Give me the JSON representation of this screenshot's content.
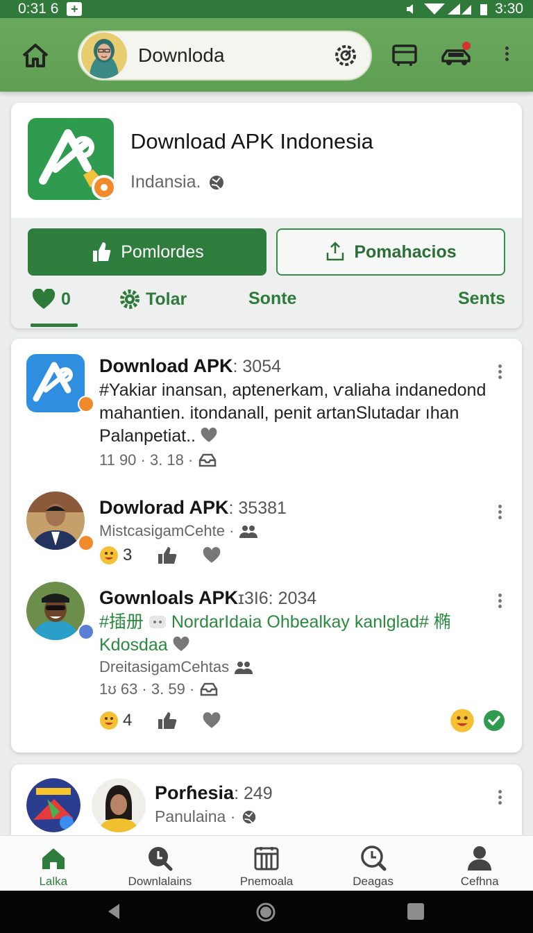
{
  "status_bar": {
    "time_left": "0:31 6",
    "time_right": "3:30"
  },
  "app_bar": {
    "search_text": "Downloda",
    "icons": [
      "home-icon",
      "gear-icon",
      "storefront-icon",
      "car-icon",
      "more-vert-icon"
    ],
    "accent": "#2e7d3c"
  },
  "hero": {
    "title": "Download APK Indonesia",
    "subtitle": "Indansia.",
    "primary_button": "Pomlordes",
    "secondary_button": "Pomahacios",
    "tabs": [
      {
        "label": "0",
        "icon": "heart-icon"
      },
      {
        "label": "Tolar",
        "icon": "gear-icon"
      },
      {
        "label": "Sonte"
      },
      {
        "label": "Sents"
      }
    ]
  },
  "feed": [
    {
      "name": "Download APK",
      "meta": ": 3054",
      "body": "#Yakiar inansan, aptenerkam, ѵaliaha indanedond mahantien. itondanall, penit artanSlutadar ıhan Palanpetiat..",
      "stats": "11 90 · 3. 18 ·"
    },
    {
      "name": "Dowlorad APK",
      "meta": ": 35381",
      "sub": "MistcasigamCehte ·",
      "reaction_count": "3"
    },
    {
      "name": "Gownloals APK",
      "meta": "ɪ3I6: 2034",
      "body_tag": "#插册",
      "body": "NordarIdaia Ohbealkay kanlglad# 椭Kdosdaa",
      "sub": "DreitasigamCehtas",
      "stats": "1ʊ 63 · 3. 59 ·",
      "reaction_count": "4"
    },
    {
      "name": "Porɦesia",
      "meta": ": 249",
      "sub": "Panulaina ·"
    }
  ],
  "bottom_nav": [
    {
      "label": "Lalka",
      "icon": "home-icon",
      "active": true
    },
    {
      "label": "Downlalains",
      "icon": "search-icon"
    },
    {
      "label": "Pnemoala",
      "icon": "grid-icon"
    },
    {
      "label": "Deagas",
      "icon": "clock-icon"
    },
    {
      "label": "Cefhna",
      "icon": "person-icon"
    }
  ]
}
